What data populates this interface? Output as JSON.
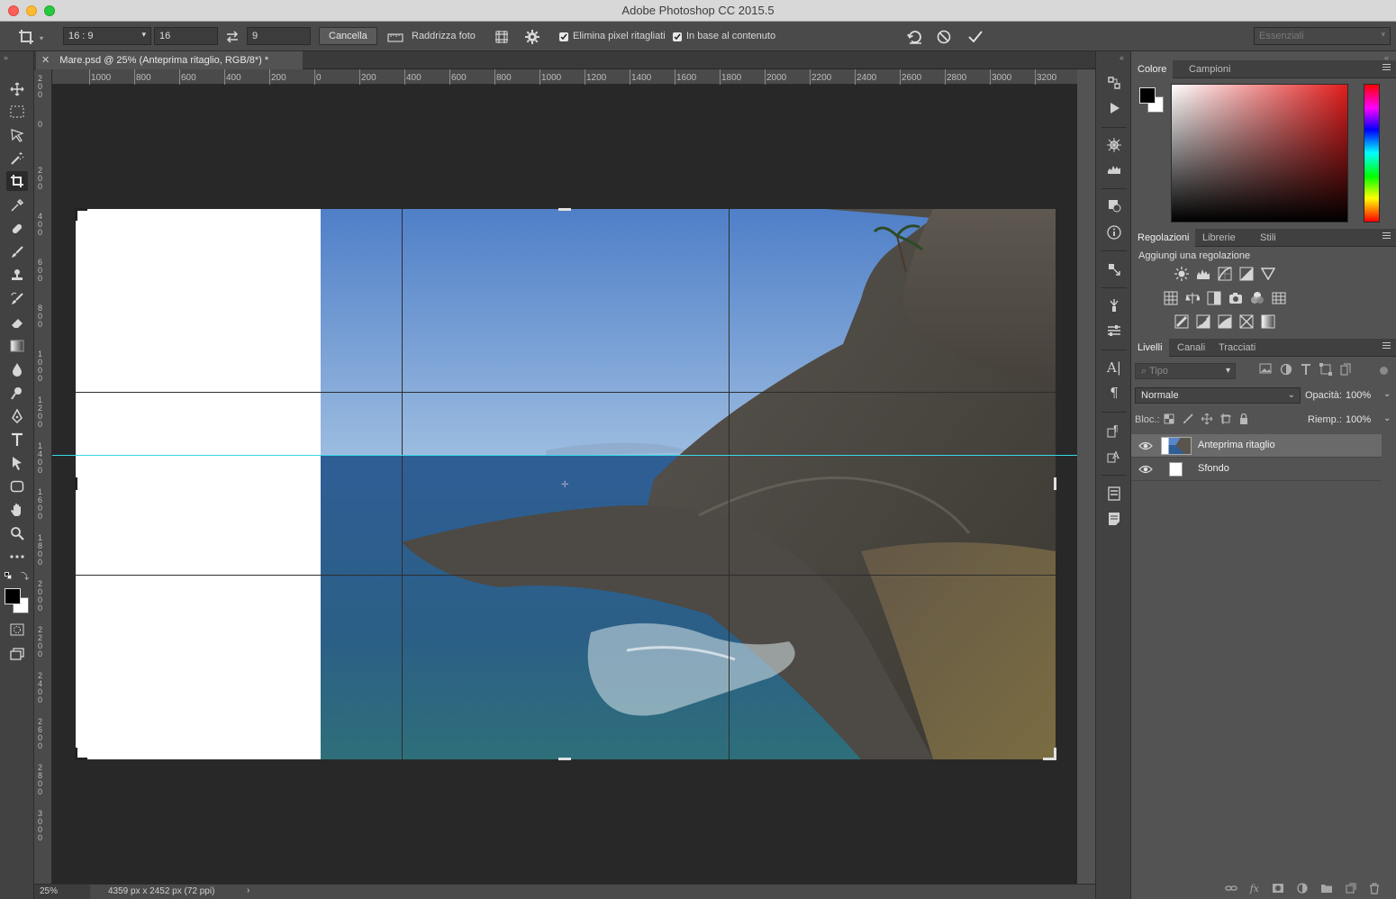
{
  "window": {
    "title": "Adobe Photoshop CC 2015.5"
  },
  "options": {
    "ratio_preset": "16 : 9",
    "width_value": "16",
    "height_value": "9",
    "cancel_label": "Cancella",
    "straighten_label": "Raddrizza foto",
    "delete_pixels_label": "Elimina pixel ritagliati",
    "delete_pixels_checked": true,
    "content_aware_label": "In base al contenuto",
    "content_aware_checked": true,
    "workspace": "Essenziali"
  },
  "document": {
    "tab_title": "Mare.psd @ 25% (Anteprima ritaglio, RGB/8*) *",
    "ruler_h_ticks": [
      "1000",
      "800",
      "600",
      "400",
      "200",
      "0",
      "200",
      "400",
      "600",
      "800",
      "1000",
      "1200",
      "1400",
      "1600",
      "1800",
      "2000",
      "2200",
      "2400",
      "2600",
      "2800",
      "3000",
      "3200"
    ],
    "ruler_v_labels": [
      "2\n0\n0",
      "0",
      "2\n0\n0",
      "4\n0\n0",
      "6\n0\n0",
      "8\n0\n0",
      "1\n0\n0\n0",
      "1\n2\n0\n0",
      "1\n4\n0\n0",
      "1\n6\n0\n0",
      "1\n8\n0\n0",
      "2\n0\n0\n0",
      "2\n2\n0\n0",
      "2\n4\n0\n0",
      "2\n6\n0\n0",
      "2\n8\n0\n0",
      "3\n0\n0\n0"
    ]
  },
  "status": {
    "zoom": "25%",
    "info": "4359 px x 2452 px (72 ppi)",
    "arrow": "›"
  },
  "panels": {
    "color_tabs": [
      "Colore",
      "Campioni"
    ],
    "adjust_tabs": [
      "Regolazioni",
      "Librerie",
      "Stili"
    ],
    "adjust_title": "Aggiungi una regolazione",
    "layer_tabs": [
      "Livelli",
      "Canali",
      "Tracciati"
    ],
    "filter_placeholder": "Tipo",
    "blend_mode": "Normale",
    "opacity_label": "Opacità:",
    "opacity_value": "100%",
    "lock_label": "Bloc.:",
    "fill_label": "Riemp.:",
    "fill_value": "100%",
    "layers": [
      {
        "name": "Anteprima ritaglio",
        "selected": true
      },
      {
        "name": "Sfondo",
        "selected": false
      }
    ]
  },
  "colors": {
    "foreground": "#000000",
    "background": "#ffffff",
    "guide": "#36d9e8"
  }
}
